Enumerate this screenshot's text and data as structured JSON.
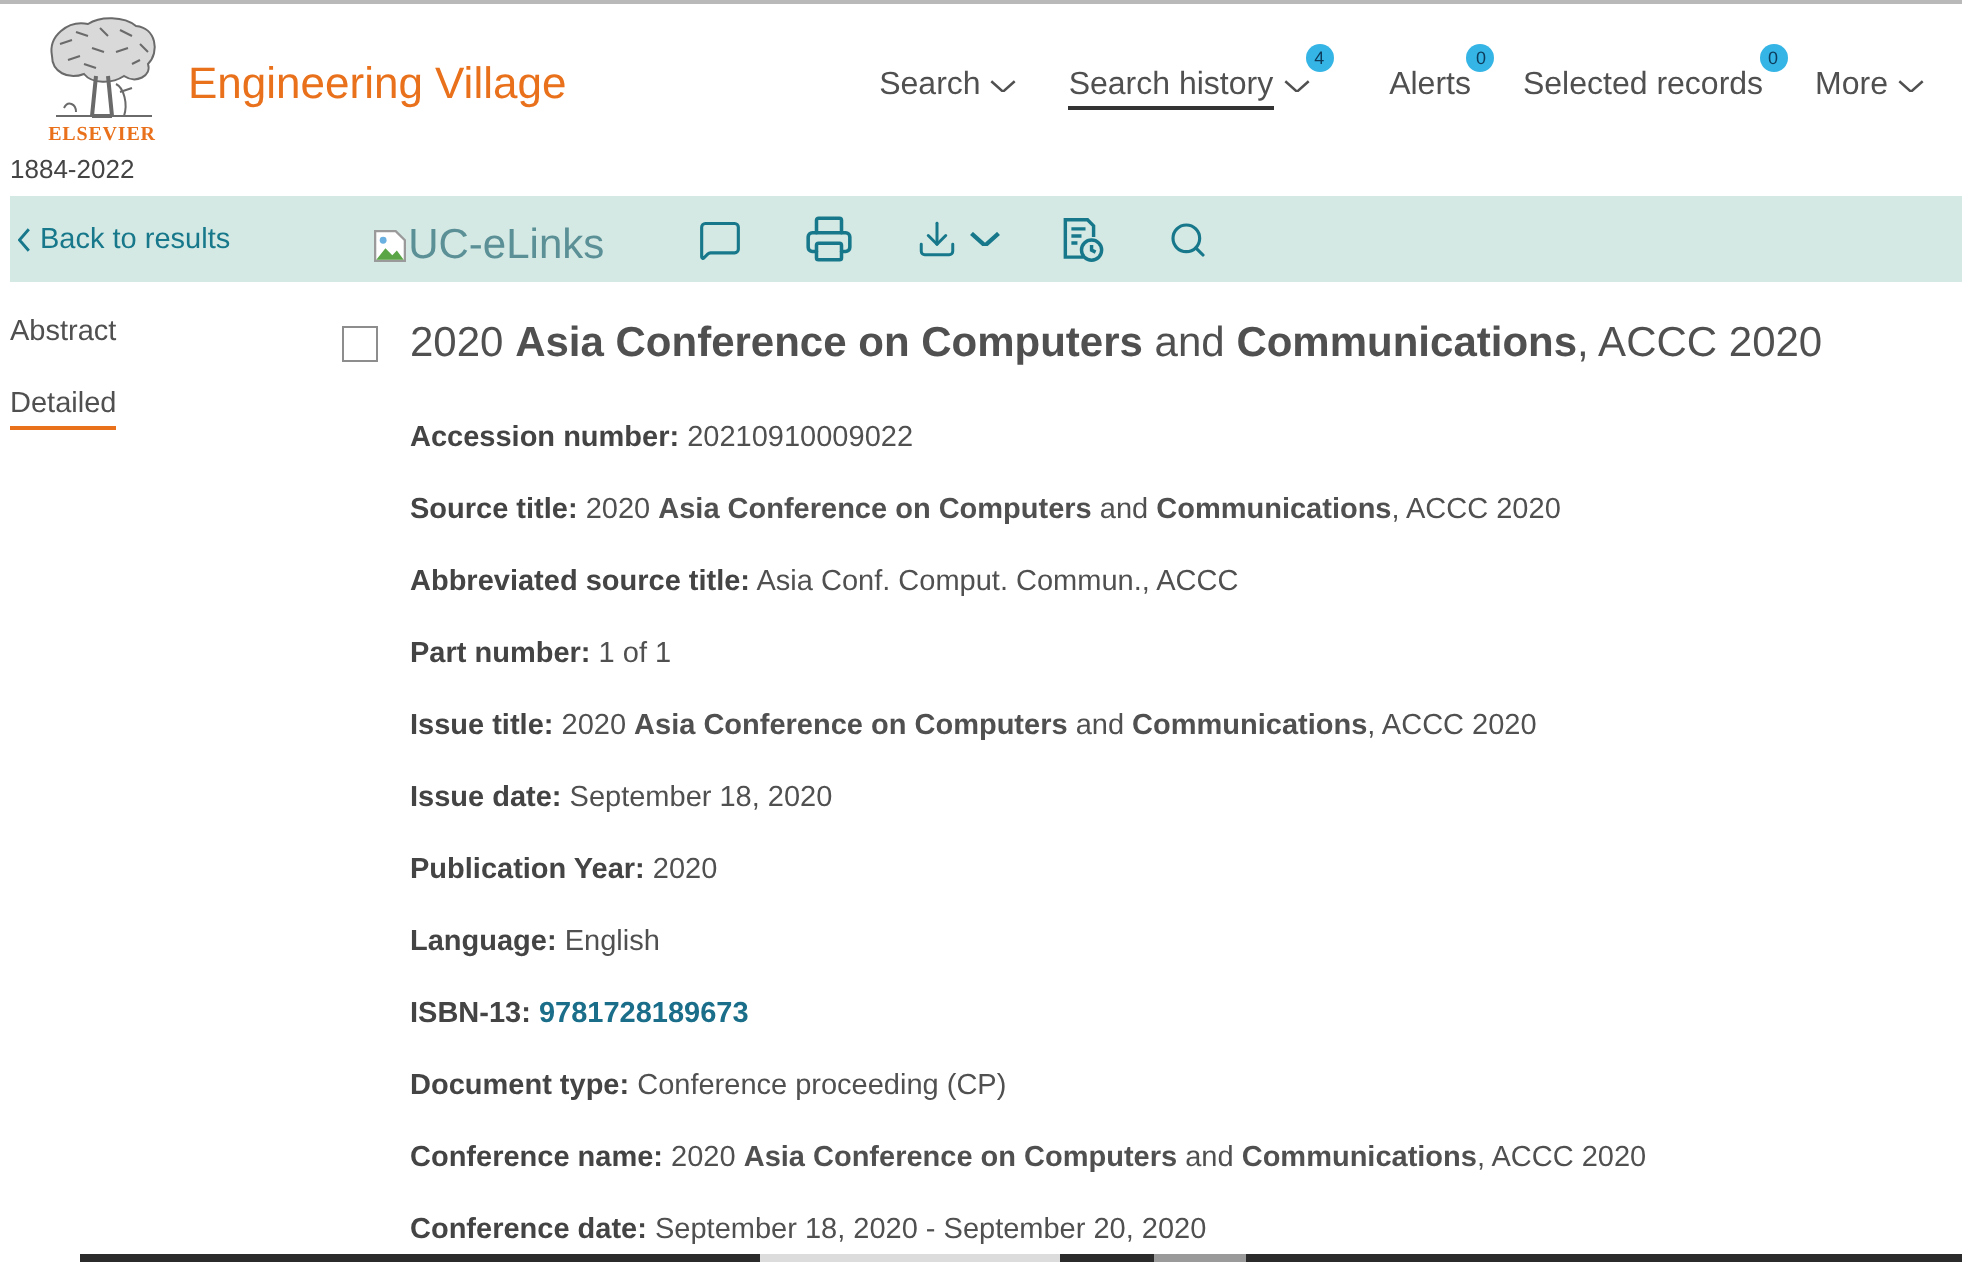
{
  "header": {
    "logo_text": "ELSEVIER",
    "years": "1884-2022",
    "app_title": "Engineering Village"
  },
  "nav": [
    {
      "label": "Search",
      "dropdown": true,
      "selected": false
    },
    {
      "label": "Search history",
      "dropdown": true,
      "selected": true,
      "badge": "4"
    },
    {
      "label": "Alerts",
      "dropdown": false,
      "selected": false,
      "badge": "0"
    },
    {
      "label": "Selected records",
      "dropdown": false,
      "selected": false,
      "badge": "0"
    },
    {
      "label": "More",
      "dropdown": true,
      "selected": false
    }
  ],
  "toolbar": {
    "back_link": "Back to results",
    "elinks_alt": "UC-eLinks"
  },
  "sidebar": {
    "tabs": [
      {
        "label": "Abstract",
        "selected": false
      },
      {
        "label": "Detailed",
        "selected": true
      }
    ]
  },
  "record": {
    "checked": false,
    "title": "2020 **Asia Conference on Computers** and **Communications**, ACCC 2020",
    "fields": [
      {
        "kind": "text",
        "label": "Accession number:",
        "value": "20210910009022"
      },
      {
        "kind": "text",
        "label": "Source title:",
        "value": "2020 **Asia Conference on Computers** and **Communications**, ACCC 2020"
      },
      {
        "kind": "text",
        "label": "Abbreviated source title:",
        "value": "Asia Conf. Comput. Commun., ACCC"
      },
      {
        "kind": "text",
        "label": "Part number:",
        "value": "1 of 1"
      },
      {
        "kind": "text",
        "label": "Issue title:",
        "value": "2020 **Asia Conference on Computers** and **Communications**, ACCC 2020"
      },
      {
        "kind": "text",
        "label": "Issue date:",
        "value": "September 18, 2020"
      },
      {
        "kind": "text",
        "label": "Publication Year:",
        "value": "2020"
      },
      {
        "kind": "text",
        "label": "Language:",
        "value": "English"
      },
      {
        "kind": "link",
        "label": "ISBN-13:",
        "value": "9781728189673"
      },
      {
        "kind": "text",
        "label": "Document type:",
        "value": "Conference proceeding (CP)"
      },
      {
        "kind": "text",
        "label": "Conference name:",
        "value": "2020 **Asia Conference on Computers** and **Communications**, ACCC 2020"
      },
      {
        "kind": "text",
        "label": "Conference date:",
        "value": "September 18, 2020 - September 20, 2020"
      }
    ]
  }
}
